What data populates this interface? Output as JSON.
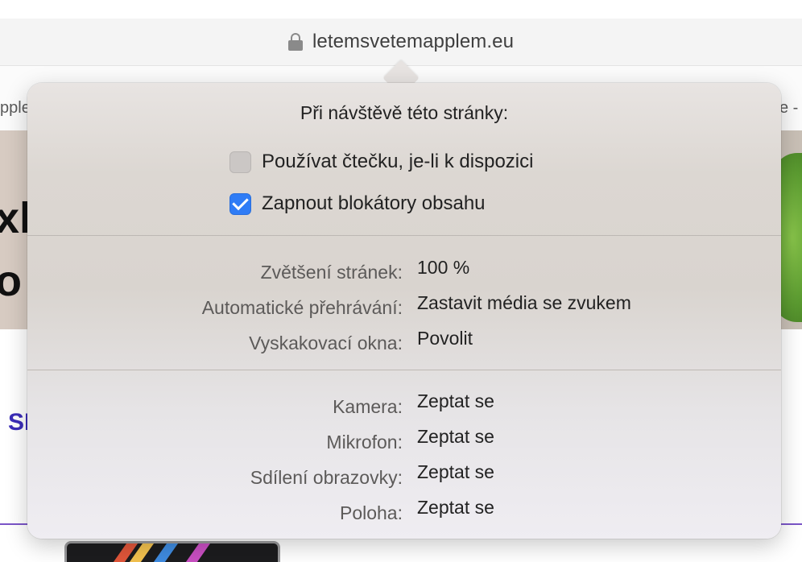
{
  "browser": {
    "url": "letemsvetemapplem.eu",
    "bookmark_left": "pple",
    "bookmark_right": "e -"
  },
  "page": {
    "hero_text_line1": "xl",
    "hero_text_line2": "o",
    "heading": "SI"
  },
  "popover": {
    "title": "Při návštěvě této stránky:",
    "checkboxes": [
      {
        "label": "Používat čtečku, je-li k dispozici",
        "checked": false
      },
      {
        "label": "Zapnout blokátory obsahu",
        "checked": true
      }
    ],
    "general_settings": [
      {
        "label": "Zvětšení stránek:",
        "value": "100 %"
      },
      {
        "label": "Automatické přehrávání:",
        "value": "Zastavit média se zvukem"
      },
      {
        "label": "Vyskakovací okna:",
        "value": "Povolit"
      }
    ],
    "permission_settings": [
      {
        "label": "Kamera:",
        "value": "Zeptat se"
      },
      {
        "label": "Mikrofon:",
        "value": "Zeptat se"
      },
      {
        "label": "Sdílení obrazovky:",
        "value": "Zeptat se"
      },
      {
        "label": "Poloha:",
        "value": "Zeptat se"
      }
    ]
  },
  "colors": {
    "accent": "#2f7cf6",
    "heading_purple": "#3b2db8"
  }
}
